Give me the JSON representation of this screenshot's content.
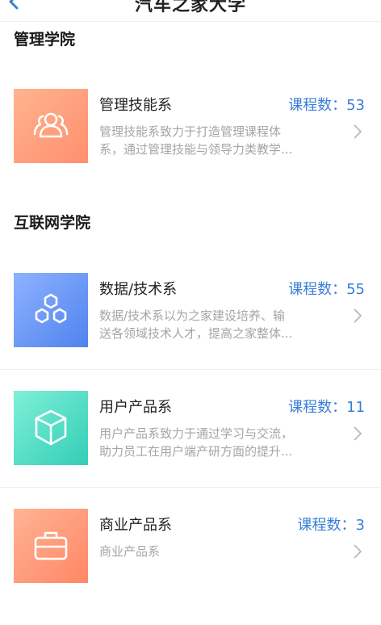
{
  "header": {
    "title": "汽车之家大学"
  },
  "sections": [
    {
      "title": "管理学院"
    },
    {
      "title": "互联网学院"
    }
  ],
  "count_label": "课程数：",
  "departments": [
    {
      "name": "管理技能系",
      "count": "53",
      "count_text": "课程数：53",
      "desc1": "管理技能系致力于打造管理课程体",
      "desc2": "系，通过管理技能与领导力类教学...",
      "icon": "people-icon",
      "gradient": [
        "#ff9a7a",
        "#ffc5a5"
      ]
    },
    {
      "name": "数据/技术系",
      "count": "55",
      "count_text": "课程数：55",
      "desc1": "数据/技术系以为之家建设培养、输",
      "desc2": "送各领域技术人才，提高之家整体...",
      "icon": "hexagon-network-icon",
      "gradient": [
        "#5b8df0",
        "#a9c3ff"
      ]
    },
    {
      "name": "用户产品系",
      "count": "11",
      "count_text": "课程数：11",
      "desc1": "用户产品系致力于通过学习与交流，",
      "desc2": "助力员工在用户端产研方面的提升...",
      "icon": "cube-icon",
      "gradient": [
        "#39d3bd",
        "#7ff0d8"
      ]
    },
    {
      "name": "商业产品系",
      "count": "3",
      "count_text": "课程数：3",
      "desc1": "商业产品系",
      "desc2": "",
      "icon": "briefcase-icon",
      "gradient": [
        "#ff8a6a",
        "#ffb090"
      ]
    }
  ]
}
